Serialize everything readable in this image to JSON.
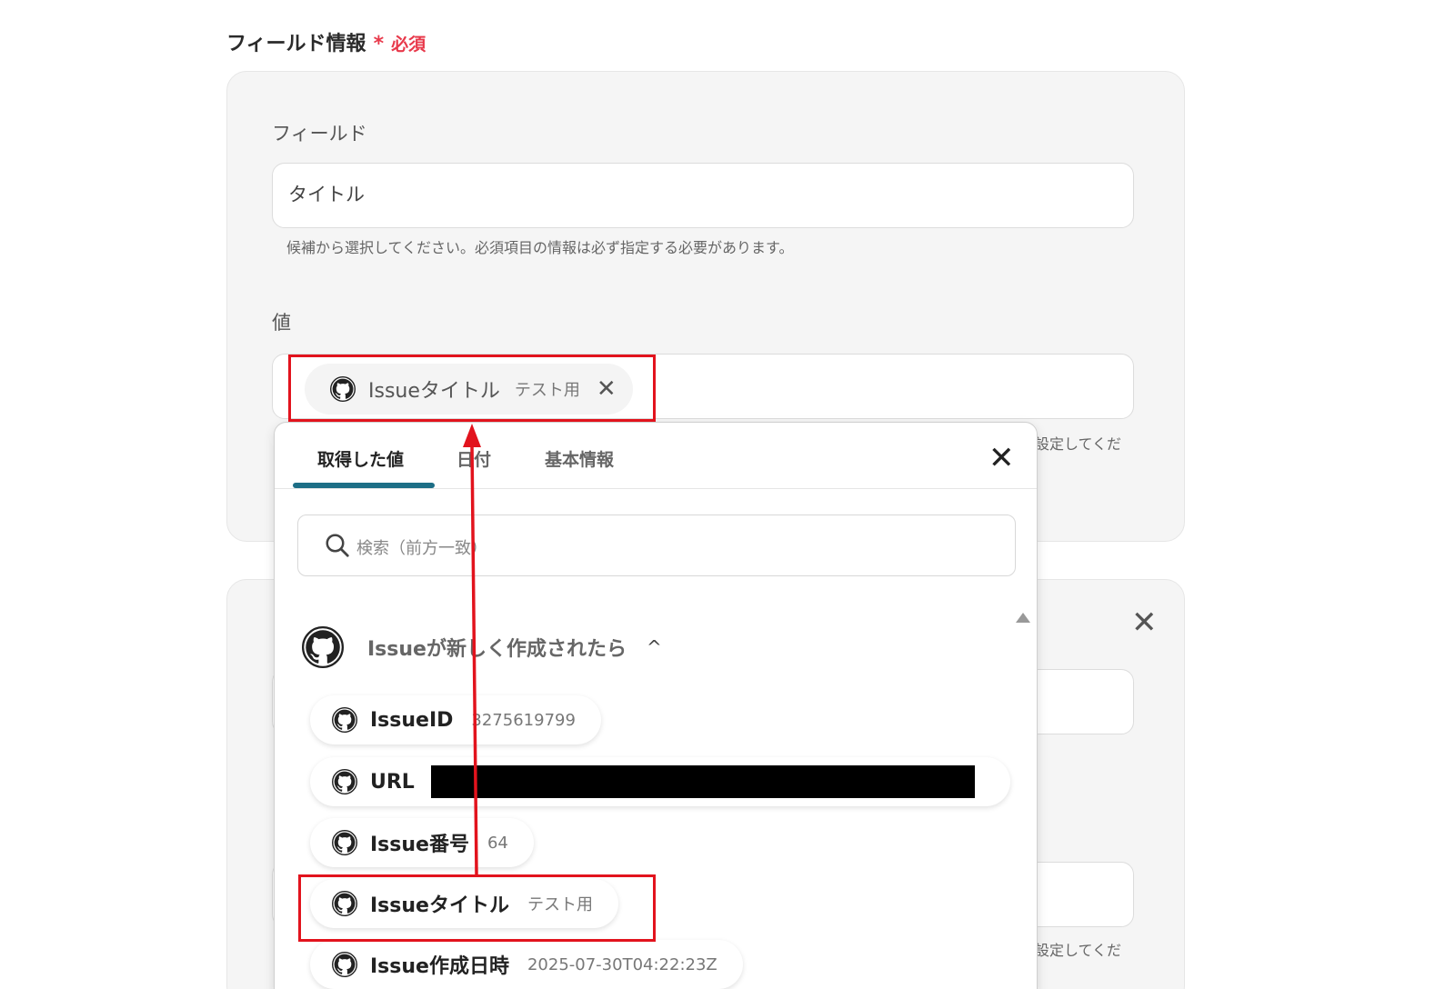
{
  "section": {
    "title": "フィールド情報",
    "required_star": "*",
    "required_label": "必須"
  },
  "field": {
    "label": "フィールド",
    "value": "タイトル",
    "help": "候補から選択してください。必須項目の情報は必ず指定する必要があります。"
  },
  "value_field": {
    "label": "値",
    "chip_label": "Issueタイトル",
    "chip_value": "テスト用",
    "chip_remove": "✕",
    "help_partial": "設定してくだ"
  },
  "popup": {
    "tabs": [
      {
        "label": "取得した値",
        "active": true
      },
      {
        "label": "日付",
        "active": false
      },
      {
        "label": "基本情報",
        "active": false
      }
    ],
    "close": "✕",
    "search_placeholder": "検索（前方一致）",
    "group_label": "Issueが新しく作成されたら",
    "group_chevron": "^",
    "items": [
      {
        "label": "IssueID",
        "value": "3275619799"
      },
      {
        "label": "URL",
        "value": ""
      },
      {
        "label": "Issue番号",
        "value": "64"
      },
      {
        "label": "Issueタイトル",
        "value": "テスト用"
      },
      {
        "label": "Issue作成日時",
        "value": "2025-07-30T04:22:23Z"
      }
    ]
  },
  "card2": {
    "close": "✕",
    "help_partial": "設定してくだ"
  },
  "colors": {
    "highlight": "#e2131d",
    "required": "#e8394b",
    "tab_accent": "#1d6e86"
  },
  "icons": {
    "item_icon": "github-icon",
    "search": "search-icon"
  }
}
